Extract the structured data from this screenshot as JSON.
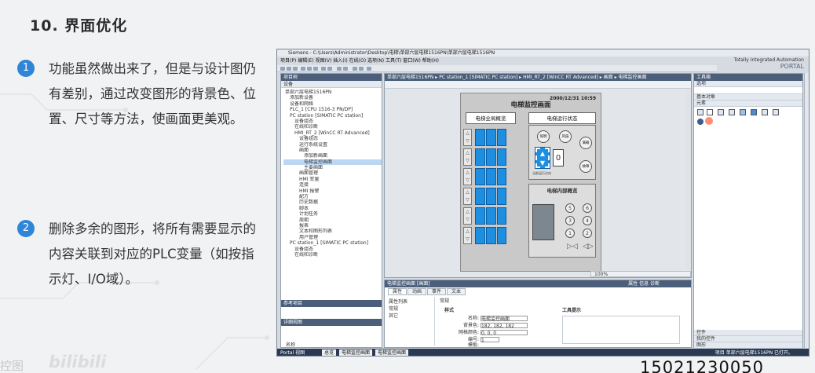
{
  "slide": {
    "title": "10. 界面优化",
    "bullets": [
      {
        "num": "1",
        "text": "功能虽然做出来了，但是与设计图仍有差别，通过改变图形的背景色、位置、尺寸等方法，使画面更美观。"
      },
      {
        "num": "2",
        "text": "删除多余的图形，将所有需要显示的内容关联到对应的PLC变量（如按指示灯、I/O域）。"
      }
    ],
    "watermark_left": "控图",
    "watermark_bili": "bilibili",
    "phone": "15021230050"
  },
  "colors": {
    "accent": "#2f86d8",
    "elevator_floor": "#1e8fe0",
    "pane_header": "#4b5f7a"
  },
  "tia": {
    "title": "Siemens - C:\\Users\\Administrator\\Desktop\\电梯\\单部六层电梯1516PN\\单部六层电梯1516PN",
    "brand_line1": "Totally Integrated Automation",
    "brand_line2": "PORTAL",
    "menu": "项目(P)  编辑(E)  视图(V)  插入(I)  在线(O)  选项(N)  工具(T)  窗口(W)  帮助(H)",
    "left_pane": {
      "header": "项目树",
      "sub": "设备",
      "tree": [
        "单部六层电梯1516PN",
        "添加新设备",
        "设备和网络",
        "PLC_1 [CPU 1516-3 PN/DP]",
        "PC station [SIMATIC PC station]",
        "设备组态",
        "在线和诊断",
        "HMI_RT_2 [WinCC RT Advanced]",
        "设备组态",
        "运行系统设置",
        "画面",
        "添加新画面",
        "电梯监控画面",
        "主要画面",
        "画面管理",
        "HMI 变量",
        "连接",
        "HMI 报警",
        "配方",
        "历史数据",
        "脚本",
        "计划任务",
        "周期",
        "报表",
        "文本和图形列表",
        "用户管理",
        "PC station_1 [SIMATIC PC station]",
        "设备组态",
        "在线和诊断"
      ],
      "ref": "参考项目",
      "detail": "详细视图",
      "detail_col": "名称"
    },
    "editor": {
      "breadcrumb": "单部六层电梯1516PN ▸ PC station_1 [SIMATIC PC station] ▸ HMI_RT_2 [WinCC RT Advanced] ▸ 画面 ▸ 电梯监控画面",
      "screen_title": "电梯监控画面",
      "datetime": "2000/12/31 10:59",
      "overview_title": "电梯全局概览",
      "state_title": "电梯运行状态",
      "buttons": [
        "照明",
        "风扇",
        "满载",
        "故障"
      ],
      "io_value": "0",
      "direction_label": "当前运行方向",
      "inner_title": "电梯内部概览",
      "floor_buttons": [
        "5",
        "6",
        "3",
        "4",
        "1",
        "2"
      ],
      "zoom": "100%"
    },
    "props": {
      "header": "电梯监控画面 [画面]",
      "tabs": [
        "属性",
        "动画",
        "事件",
        "文本"
      ],
      "tab_right": "属性  信息  诊断",
      "side": [
        "属性列表",
        "常规",
        "其它"
      ],
      "section": "常规",
      "style_label": "样式",
      "name_label": "名称:",
      "name_value": "电梯监控画面",
      "bg_label": "背景色:",
      "bg_value": "182, 182, 182",
      "grid_label": "网格颜色:",
      "grid_value": "0, 0, 0",
      "num_label": "编号:",
      "num_value": "1",
      "template_label": "模板:",
      "tooltip_label": "工具提示"
    },
    "right_pane": {
      "header": "工具箱",
      "options": "选项",
      "basic": "基本对象",
      "elements": "元素",
      "controls": "控件",
      "my_controls": "我的控件",
      "graphics": "图形"
    },
    "status": {
      "portal": "Portal 视图",
      "tab1": "总览",
      "tab2": "电梯监控画面",
      "tab3": "电梯监控画面",
      "message": "项目 单部六层电梯1516PN 已打开。"
    }
  }
}
